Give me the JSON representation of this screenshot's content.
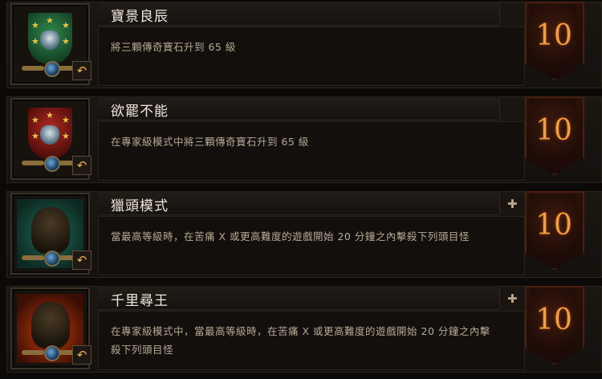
{
  "achievements": [
    {
      "title": "寶景良辰",
      "description": "將三顆傳奇寶石升到 65 級",
      "points": "10",
      "banner_color": "#1f6b3b",
      "icon": "banner-crest-icon"
    },
    {
      "title": "欲罷不能",
      "description": "在專家級模式中將三顆傳奇寶石升到 65 級",
      "points": "10",
      "banner_color": "#8a1a14",
      "icon": "banner-crest-icon"
    },
    {
      "title": "獵頭模式",
      "description": "當最高等級時，在苦痛 X 或更高難度的遊戲開始 20 分鐘之內擊殺下列頭目怪",
      "points": "10",
      "banner_color": "#1b5a4a",
      "icon": "skull-icon",
      "expandable": true
    },
    {
      "title": "千里尋王",
      "description": "在專家級模式中，當最高等級時，在苦痛 X 或更高難度的遊戲開始 20 分鐘之內擊殺下列頭目怪",
      "points": "10",
      "banner_color": "#9a2a0c",
      "icon": "skull-icon",
      "expandable": true
    }
  ],
  "glyphs": {
    "restore": "↶",
    "expand": "✚",
    "star": "★"
  }
}
